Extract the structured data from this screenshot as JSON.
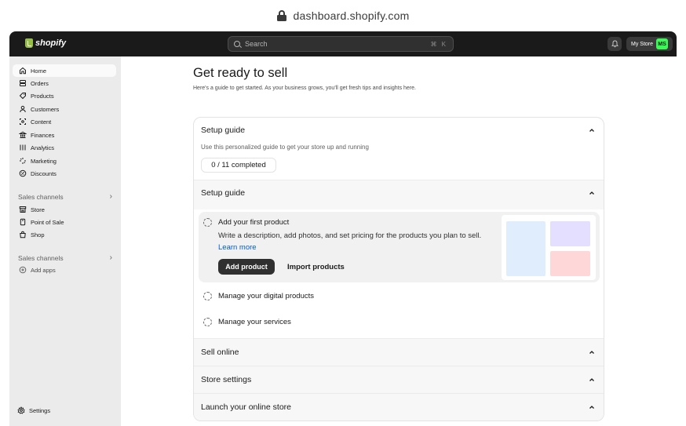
{
  "browser": {
    "url": "dashboard.shopify.com"
  },
  "topbar": {
    "logo_text": "shopify",
    "search_placeholder": "Search",
    "search_shortcut": "⌘ K",
    "store_name": "My Store",
    "store_initials": "MS",
    "colors": {
      "bar": "#1a1a1a",
      "avatar": "#36fc53",
      "logo": "#95bf47"
    }
  },
  "sidebar": {
    "items": [
      {
        "label": "Home",
        "icon": "home-icon"
      },
      {
        "label": "Orders",
        "icon": "orders-icon"
      },
      {
        "label": "Products",
        "icon": "tag-icon"
      },
      {
        "label": "Customers",
        "icon": "person-icon"
      },
      {
        "label": "Content",
        "icon": "content-icon"
      },
      {
        "label": "Finances",
        "icon": "bank-icon"
      },
      {
        "label": "Analytics",
        "icon": "bar-chart-icon"
      },
      {
        "label": "Marketing",
        "icon": "target-icon"
      },
      {
        "label": "Discounts",
        "icon": "discount-icon"
      }
    ],
    "sales_channels_label": "Sales channels",
    "channels": [
      {
        "label": "Store",
        "icon": "storefront-icon"
      },
      {
        "label": "Point of Sale",
        "icon": "pos-icon"
      },
      {
        "label": "Shop",
        "icon": "shopping-bag-icon"
      }
    ],
    "apps_label": "Sales channels",
    "add_apps": "Add apps",
    "settings": "Settings"
  },
  "main": {
    "title": "Get ready to sell",
    "subtitle": "Here's a guide to get started. As your business grows, you'll get fresh tips and insights here.",
    "guide": {
      "title": "Setup guide",
      "description": "Use this personalized guide to get your store up and running",
      "progress": "0 / 11 completed"
    },
    "section": {
      "title": "Setup guide",
      "active_task": {
        "title": "Add your first product",
        "description": "Write a description, add photos, and set pricing for the products you plan to sell.",
        "link": "Learn more",
        "primary_button": "Add product",
        "secondary_button": "Import products"
      },
      "tasks": [
        "Manage your digital products",
        "Manage your services"
      ]
    },
    "collapsed_sections": [
      "Sell online",
      "Store settings",
      "Launch your online store"
    ],
    "colors": {
      "link": "#005bd3",
      "primary_button": "#303030",
      "sidebar_bg": "#ebebeb"
    }
  }
}
